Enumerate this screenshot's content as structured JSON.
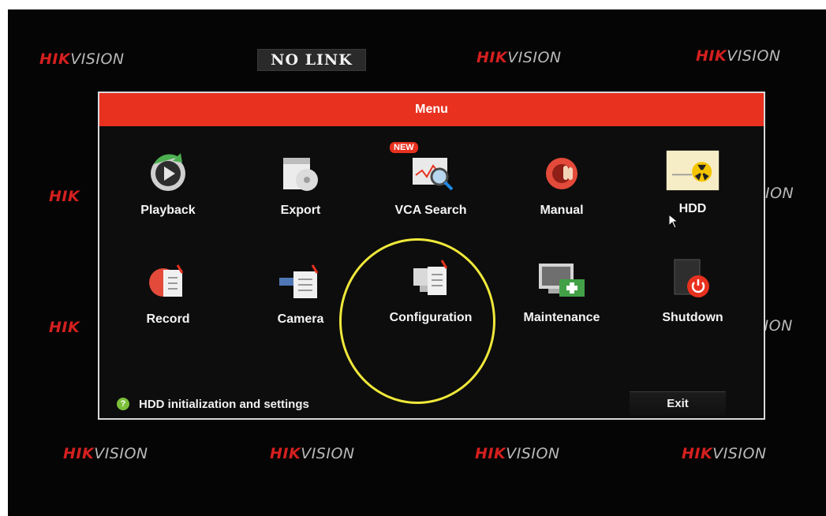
{
  "watermark": {
    "brand": "HIK",
    "suffix": "VISION"
  },
  "status": {
    "no_link": "NO LINK"
  },
  "menu": {
    "title": "Menu",
    "items": [
      {
        "label": "Playback",
        "icon": "playback-icon"
      },
      {
        "label": "Export",
        "icon": "export-icon"
      },
      {
        "label": "VCA Search",
        "icon": "vca-search-icon",
        "badge": "NEW"
      },
      {
        "label": "Manual",
        "icon": "manual-icon"
      },
      {
        "label": "HDD",
        "icon": "hdd-icon"
      },
      {
        "label": "Record",
        "icon": "record-icon"
      },
      {
        "label": "Camera",
        "icon": "camera-icon"
      },
      {
        "label": "Configuration",
        "icon": "configuration-icon"
      },
      {
        "label": "Maintenance",
        "icon": "maintenance-icon"
      },
      {
        "label": "Shutdown",
        "icon": "shutdown-icon"
      }
    ],
    "hint": "HDD initialization and settings",
    "exit": "Exit"
  },
  "colors": {
    "accent": "#e8311f",
    "highlight_circle": "#efe83a",
    "hint": "#7cbf3a"
  }
}
